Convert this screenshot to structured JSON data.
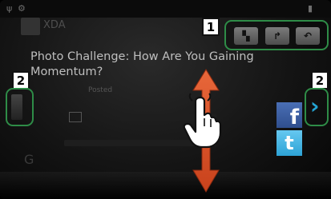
{
  "status_bar": {
    "left_icons": [
      "usb-icon",
      "android-icon"
    ],
    "right_icons": [
      "battery-icon"
    ]
  },
  "app": {
    "name": "XDA"
  },
  "article": {
    "title": "Photo Challenge: How Are You Gaining Momentum?",
    "byline": "Posted"
  },
  "callouts": {
    "toolbar": "1",
    "left_side": "2",
    "right_side": "2"
  },
  "toolbar": {
    "buttons": [
      "bookmark-icon",
      "share-icon",
      "back-icon"
    ]
  },
  "social": {
    "facebook": "f",
    "twitter": "t"
  },
  "gesture": {
    "icon": "hand-pointer-icon",
    "direction": "vertical-scroll"
  },
  "colors": {
    "highlight": "#2e8c47",
    "arrow": "#d9532a",
    "nav_arrow": "#24a5d4"
  }
}
